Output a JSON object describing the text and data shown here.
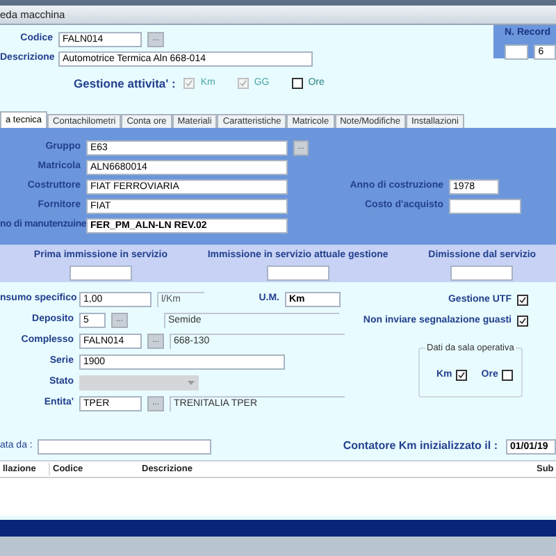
{
  "window": {
    "title": "eda macchina"
  },
  "header": {
    "codice": {
      "label": "Codice",
      "value": "FALN014",
      "browse": "..."
    },
    "descrizione": {
      "label": "Descrizione",
      "value": "Automotrice Termica Aln 668-014"
    },
    "record": {
      "label": "N. Record",
      "value": "6"
    },
    "gestione": {
      "label": "Gestione attivita' :",
      "options": [
        {
          "label": "Km",
          "checked": true,
          "disabled": true
        },
        {
          "label": "GG",
          "checked": true,
          "disabled": true
        },
        {
          "label": "Ore",
          "checked": false,
          "disabled": false
        }
      ]
    }
  },
  "tabs": [
    {
      "label": "a tecnica",
      "selected": true
    },
    {
      "label": "Contachilometri",
      "selected": false
    },
    {
      "label": "Conta ore",
      "selected": false
    },
    {
      "label": "Materiali",
      "selected": false
    },
    {
      "label": "Caratteristiche",
      "selected": false
    },
    {
      "label": "Matricole",
      "selected": false
    },
    {
      "label": "Note/Modifiche",
      "selected": false
    },
    {
      "label": "Installazioni",
      "selected": false
    }
  ],
  "technical": {
    "gruppo": {
      "label": "Gruppo",
      "value": "E63",
      "browse": "..."
    },
    "matricola": {
      "label": "Matricola",
      "value": "ALN6680014"
    },
    "costruttore": {
      "label": "Costruttore",
      "value": "FIAT FERROVIARIA"
    },
    "fornitore": {
      "label": "Fornitore",
      "value": "FIAT"
    },
    "piano": {
      "label": "no di manutenzuine",
      "value": "FER_PM_ALN-LN REV.02"
    },
    "anno": {
      "label": "Anno di costruzione",
      "value": "1978"
    },
    "costo": {
      "label": "Costo d'acquisto"
    }
  },
  "dates": [
    {
      "label": "Prima immissione in servizio"
    },
    {
      "label": "Immissione in servizio attuale gestione"
    },
    {
      "label": "Dimissione dal servizio"
    }
  ],
  "details": {
    "consumo": {
      "label": "nsumo specifico",
      "value": "1,00",
      "unit": "l/Km"
    },
    "um": {
      "label": "U.M.",
      "value": "Km"
    },
    "deposito": {
      "label": "Deposito",
      "value": "5",
      "name": "Semide",
      "browse": "..."
    },
    "complesso": {
      "label": "Complesso",
      "value": "FALN014",
      "name": "668-130",
      "browse": "..."
    },
    "serie": {
      "label": "Serie",
      "value": "1900"
    },
    "stato": {
      "label": "Stato",
      "disabled": true
    },
    "entita": {
      "label": "Entita'",
      "value": "TPER",
      "name": "TRENITALIA TPER",
      "browse": "..."
    },
    "flags": [
      {
        "label": "Gestione UTF",
        "checked": true
      },
      {
        "label": "Non inviare segnalazione guasti",
        "checked": true
      }
    ],
    "sala": {
      "title": "Dati da sala operativa",
      "options": [
        {
          "label": "Km",
          "checked": true
        },
        {
          "label": "Ore",
          "checked": false
        }
      ]
    }
  },
  "footer": {
    "origine": {
      "label": "ata da :"
    },
    "contatore": {
      "label": "Contatore Km inizializzato il :",
      "value": "01/01/19"
    }
  },
  "table": {
    "columns": [
      "llazione",
      "Codice",
      "Descrizione",
      "Sub"
    ]
  }
}
